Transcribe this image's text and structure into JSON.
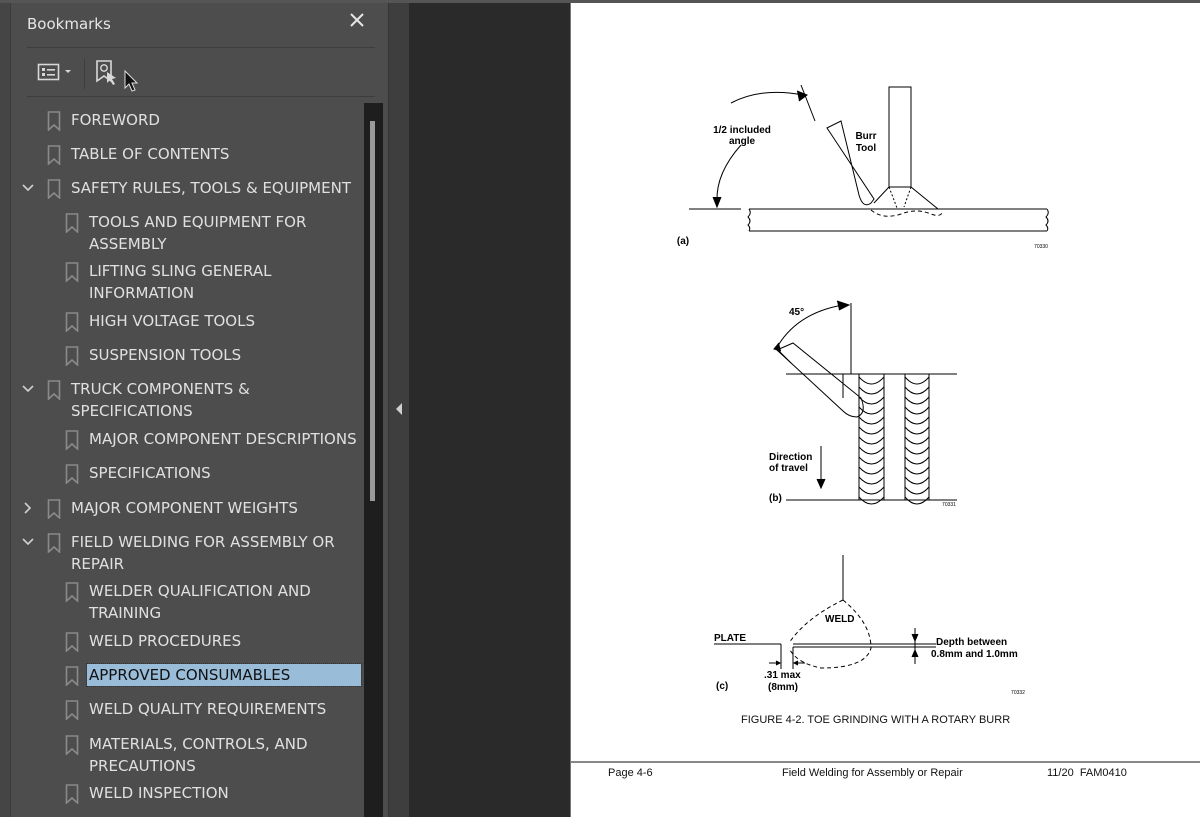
{
  "bookmarks_panel": {
    "title": "Bookmarks",
    "close_icon": "close-icon",
    "toolbar": {
      "options_icon": "list-options-icon",
      "find_bookmark_icon": "find-current-bookmark-icon"
    },
    "items": [
      {
        "label": "FOREWORD",
        "level": 0,
        "expander": "none"
      },
      {
        "label": "TABLE OF CONTENTS",
        "level": 0,
        "expander": "none"
      },
      {
        "label": "SAFETY RULES, TOOLS & EQUIPMENT",
        "level": 0,
        "expander": "expanded"
      },
      {
        "label": "TOOLS AND EQUIPMENT FOR ASSEMBLY",
        "level": 1,
        "expander": "none"
      },
      {
        "label": "LIFTING SLING GENERAL INFORMATION",
        "level": 1,
        "expander": "none"
      },
      {
        "label": "HIGH VOLTAGE TOOLS",
        "level": 1,
        "expander": "none"
      },
      {
        "label": "SUSPENSION TOOLS",
        "level": 1,
        "expander": "none"
      },
      {
        "label": "TRUCK COMPONENTS & SPECIFICATIONS",
        "level": 0,
        "expander": "expanded"
      },
      {
        "label": "MAJOR COMPONENT DESCRIPTIONS",
        "level": 1,
        "expander": "none"
      },
      {
        "label": "SPECIFICATIONS",
        "level": 1,
        "expander": "none"
      },
      {
        "label": "MAJOR COMPONENT WEIGHTS",
        "level": 0,
        "expander": "collapsed"
      },
      {
        "label": "FIELD WELDING FOR ASSEMBLY OR REPAIR",
        "level": 0,
        "expander": "expanded"
      },
      {
        "label": "WELDER QUALIFICATION AND TRAINING",
        "level": 1,
        "expander": "none"
      },
      {
        "label": "WELD PROCEDURES",
        "level": 1,
        "expander": "none"
      },
      {
        "label": "APPROVED CONSUMABLES",
        "level": 1,
        "expander": "none",
        "selected": true
      },
      {
        "label": "WELD QUALITY REQUIREMENTS",
        "level": 1,
        "expander": "none"
      },
      {
        "label": "MATERIALS, CONTROLS, AND PRECAUTIONS",
        "level": 1,
        "expander": "none"
      },
      {
        "label": "WELD INSPECTION",
        "level": 1,
        "expander": "none"
      }
    ]
  },
  "collapse_panel_icon": "collapse-left-icon",
  "document": {
    "figure_a": {
      "angle_label_1": "1/2 included",
      "angle_label_2": "angle",
      "tool_label_1": "Burr",
      "tool_label_2": "Tool",
      "panel": "(a)",
      "code": "70330"
    },
    "figure_b": {
      "angle": "45°",
      "direction_1": "Direction",
      "direction_2": "of travel",
      "panel": "(b)",
      "code": "70331"
    },
    "figure_c": {
      "weld": "WELD",
      "plate": "PLATE",
      "depth_1": "Depth between",
      "depth_2": "0.8mm and 1.0mm",
      "max_1": ".31 max",
      "max_2": "(8mm)",
      "panel": "(c)",
      "code": "70332"
    },
    "caption": "FIGURE 4-2. TOE GRINDING WITH A ROTARY BURR",
    "footer": {
      "page": "Page 4-6",
      "section": "Field Welding for Assembly or Repair",
      "revision": "11/20  FAM0410"
    }
  }
}
